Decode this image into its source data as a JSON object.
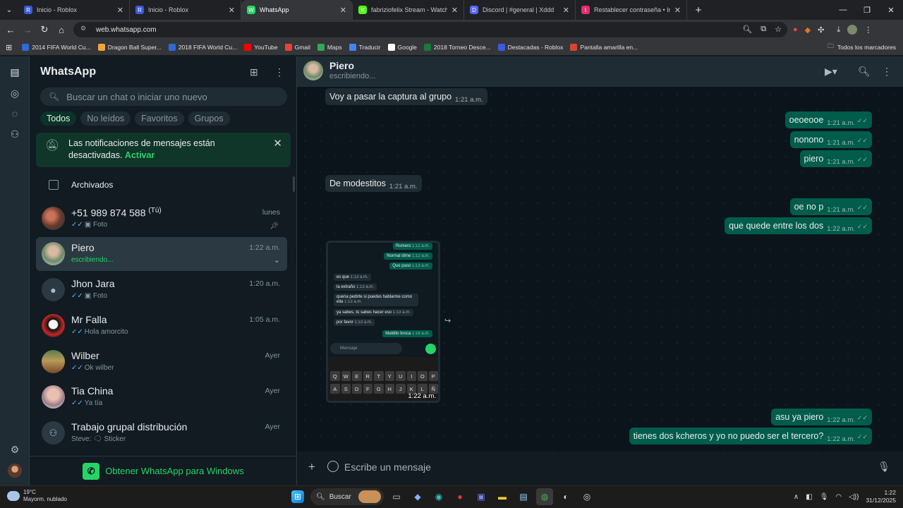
{
  "browser": {
    "tabs": [
      {
        "title": "Inicio - Roblox",
        "fav_color": "#3b5bdb",
        "fav_char": "R"
      },
      {
        "title": "Inicio - Roblox",
        "fav_color": "#3b5bdb",
        "fav_char": "R"
      },
      {
        "title": "WhatsApp",
        "fav_color": "#25d366",
        "fav_char": "W"
      },
      {
        "title": "fabriziofelix Stream - Watch",
        "fav_color": "#53fc18",
        "fav_char": "K"
      },
      {
        "title": "Discord | #general | Xddd",
        "fav_color": "#5865f2",
        "fav_char": "D"
      },
      {
        "title": "Restablecer contraseña • Instag",
        "fav_color": "#e1306c",
        "fav_char": "I"
      }
    ],
    "url": "web.whatsapp.com",
    "bookmarks": [
      {
        "label": "2014 FIFA World Cu...",
        "color": "#2e6bd6"
      },
      {
        "label": "Dragon Ball Super...",
        "color": "#f2a33a"
      },
      {
        "label": "2018 FIFA World Cu...",
        "color": "#2e6bd6"
      },
      {
        "label": "YouTube",
        "color": "#ff0000"
      },
      {
        "label": "Gmail",
        "color": "#ea4335"
      },
      {
        "label": "Maps",
        "color": "#34a853"
      },
      {
        "label": "Traducir",
        "color": "#4285f4"
      },
      {
        "label": "Google",
        "color": "#ffffff"
      },
      {
        "label": "2018 Torneo Desce...",
        "color": "#1a7a3a"
      },
      {
        "label": "Destacadas - Roblox",
        "color": "#3b5bdb"
      },
      {
        "label": "Pantalla amarilla en...",
        "color": "#d3472e"
      }
    ],
    "all_bookmarks": "Todos los marcadores"
  },
  "sidebar": {
    "title": "WhatsApp",
    "search_placeholder": "Buscar un chat o iniciar uno nuevo",
    "filters": [
      "Todos",
      "No leídos",
      "Favoritos",
      "Grupos"
    ],
    "notification": {
      "text": "Las notificaciones de mensajes están desactivadas.",
      "action": "Activar"
    },
    "archived": "Archivados",
    "chats": [
      {
        "name": "+51 989 874 588",
        "suffix": "(Tú)",
        "time": "lunes",
        "preview": "Foto"
      },
      {
        "name": "Piero",
        "time": "1:22 a.m.",
        "preview": "escribiendo..."
      },
      {
        "name": "Jhon Jara",
        "time": "1:20 a.m.",
        "preview": "Foto"
      },
      {
        "name": "Mr Falla",
        "time": "1:05 a.m.",
        "preview": "Hola amorcito"
      },
      {
        "name": "Wilber",
        "time": "Ayer",
        "preview": "Ok wilber"
      },
      {
        "name": "Tia China",
        "time": "Ayer",
        "preview": "Ya tía"
      },
      {
        "name": "Trabajo grupal distribución",
        "time": "Ayer",
        "preview": "Steve: 🗨 Sticker"
      }
    ],
    "get_windows": "Obtener WhatsApp para Windows"
  },
  "conversation": {
    "contact": "Piero",
    "status": "escribiendo...",
    "messages": [
      {
        "dir": "in",
        "text": "Voy a pasar la captura al grupo",
        "time": "1:21 a.m."
      },
      {
        "dir": "out",
        "text": "oeoeooe",
        "time": "1:21 a.m."
      },
      {
        "dir": "out",
        "text": "nonono",
        "time": "1:21 a.m."
      },
      {
        "dir": "out",
        "text": "piero",
        "time": "1:21 a.m."
      },
      {
        "dir": "in",
        "text": "De modestitos",
        "time": "1:21 a.m."
      },
      {
        "dir": "out",
        "text": "oe no p",
        "time": "1:21 a.m."
      },
      {
        "dir": "out",
        "text": "que quede entre los dos",
        "time": "1:22 a.m."
      },
      {
        "dir": "out",
        "text": "asu ya piero",
        "time": "1:22 a.m."
      },
      {
        "dir": "out",
        "text": "tienes dos kcheros y yo no puedo ser el tercero?",
        "time": "1:22 a.m."
      }
    ],
    "image_message": {
      "time": "1:22 a.m.",
      "inner_messages": [
        {
          "dir": "o",
          "text": "Romero",
          "time": "1:12 a.m."
        },
        {
          "dir": "o",
          "text": "Normal dime",
          "time": "1:12 a.m."
        },
        {
          "dir": "o",
          "text": "Que paso",
          "time": "1:13 a.m."
        },
        {
          "dir": "i",
          "text": "es que",
          "time": "1:13 a.m."
        },
        {
          "dir": "i",
          "text": "la extraño",
          "time": "1:13 a.m."
        },
        {
          "dir": "i",
          "text": "queria pedirte si puedes hablarme como ella",
          "time": "1:13 a.m."
        },
        {
          "dir": "i",
          "text": "ya sabes, tú sabes hacer eso",
          "time": "1:13 a.m."
        },
        {
          "dir": "i",
          "text": "por favor",
          "time": "1:13 a.m."
        },
        {
          "dir": "o",
          "text": "Maldito broca",
          "time": "1:16 a.m."
        }
      ],
      "input_placeholder": "Mensaje",
      "keyboard_row1": [
        "Q",
        "W",
        "E",
        "R",
        "T",
        "Y",
        "U",
        "I",
        "O",
        "P"
      ],
      "keyboard_row2": [
        "A",
        "S",
        "D",
        "F",
        "G",
        "H",
        "J",
        "K",
        "L",
        "Ñ"
      ]
    },
    "composer_placeholder": "Escribe un mensaje"
  },
  "taskbar": {
    "weather_temp": "19°C",
    "weather_desc": "Mayorm. nublado",
    "search": "Buscar",
    "time": "1:22",
    "date": "31/12/2025"
  }
}
